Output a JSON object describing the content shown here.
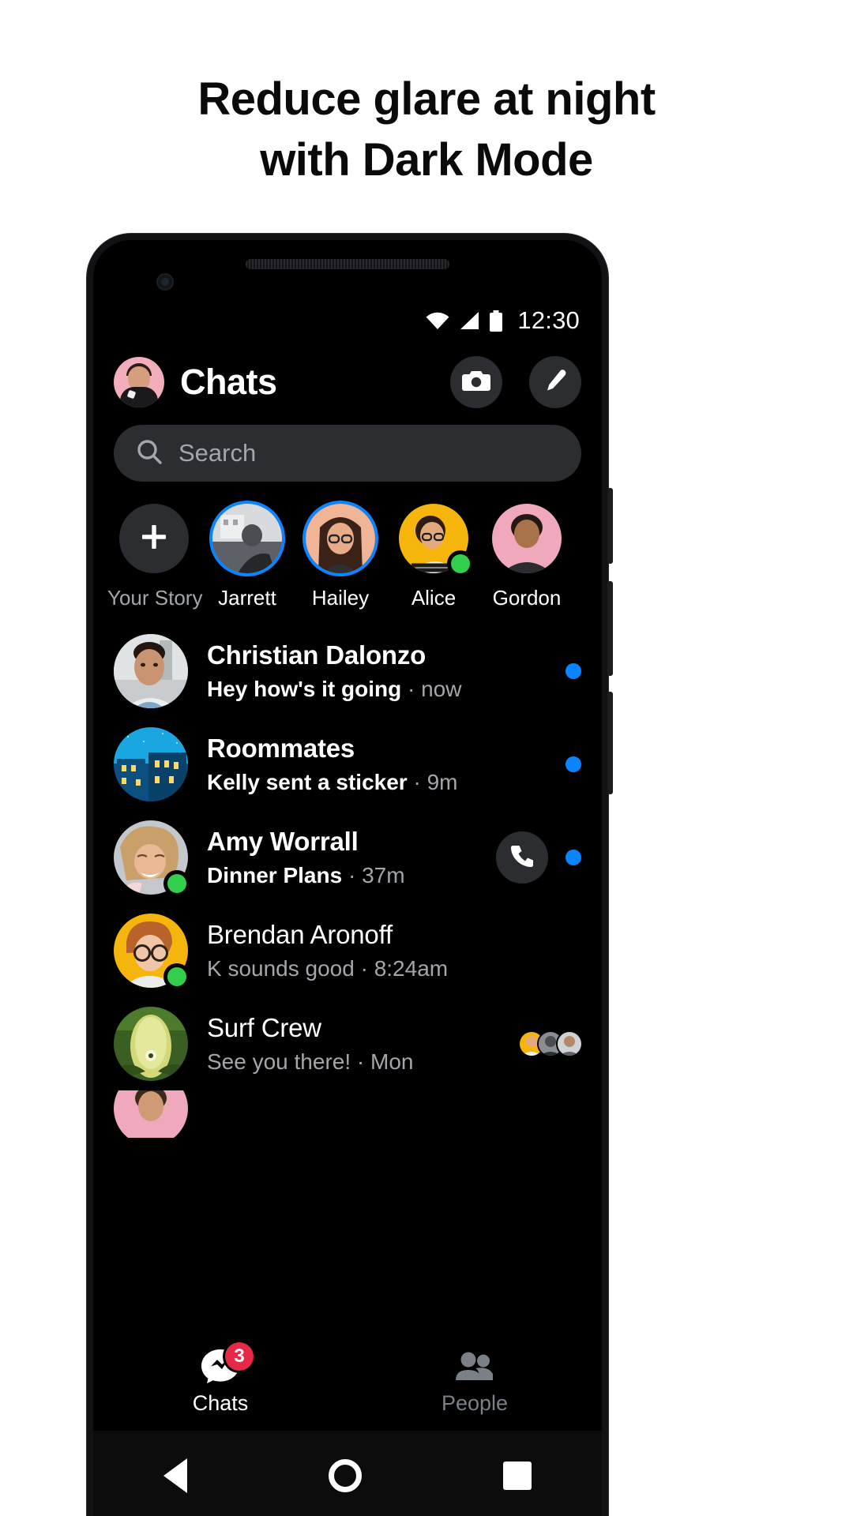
{
  "headline": "Reduce glare at night with Dark Mode",
  "headline_line1": "Reduce glare at night",
  "headline_line2": "with Dark Mode",
  "status_bar": {
    "time": "12:30",
    "icons": [
      "wifi-icon",
      "cellular-signal-icon",
      "battery-icon"
    ]
  },
  "header": {
    "title": "Chats",
    "avatar_name": "profile-avatar",
    "camera_label": "camera-icon",
    "compose_label": "compose-icon"
  },
  "search": {
    "placeholder": "Search",
    "value": "",
    "icon": "search-icon"
  },
  "stories": [
    {
      "label": "Your Story",
      "type": "add",
      "ring": false,
      "online": false,
      "dim": true
    },
    {
      "label": "Jarrett",
      "type": "photo",
      "ring": true,
      "online": false,
      "dim": false
    },
    {
      "label": "Hailey",
      "type": "photo",
      "ring": true,
      "online": false,
      "dim": false
    },
    {
      "label": "Alice",
      "type": "photo",
      "ring": false,
      "online": true,
      "dim": false
    },
    {
      "label": "Gordon",
      "type": "photo",
      "ring": false,
      "online": false,
      "dim": false
    }
  ],
  "chats": [
    {
      "name": "Christian Dalonzo",
      "snippet": "Hey how's it going",
      "time": "now",
      "unread": true,
      "online": false,
      "call_button": false,
      "seen_by": 0
    },
    {
      "name": "Roommates",
      "snippet": "Kelly sent a sticker",
      "time": "9m",
      "unread": true,
      "online": false,
      "call_button": false,
      "seen_by": 0
    },
    {
      "name": "Amy Worrall",
      "snippet": "Dinner Plans",
      "time": "37m",
      "unread": true,
      "online": true,
      "call_button": true,
      "seen_by": 0
    },
    {
      "name": "Brendan Aronoff",
      "snippet": "K sounds good",
      "time": "8:24am",
      "unread": false,
      "online": true,
      "call_button": false,
      "seen_by": 0
    },
    {
      "name": "Surf Crew",
      "snippet": "See you there!",
      "time": "Mon",
      "unread": false,
      "online": false,
      "call_button": false,
      "seen_by": 3
    }
  ],
  "bottom_nav": [
    {
      "label": "Chats",
      "icon": "chat-bubble-icon",
      "badge": "3",
      "active": true
    },
    {
      "label": "People",
      "icon": "people-icon",
      "badge": "",
      "active": false
    }
  ],
  "android_nav": {
    "back": "back-triangle-icon",
    "home": "home-circle-icon",
    "recents": "recents-square-icon"
  },
  "colors": {
    "accent_blue": "#0a84ff",
    "online_green": "#31cf4b",
    "badge_red": "#e52946",
    "surface": "#2b2d30",
    "background": "#000000",
    "muted_text": "#a3a6ab"
  }
}
